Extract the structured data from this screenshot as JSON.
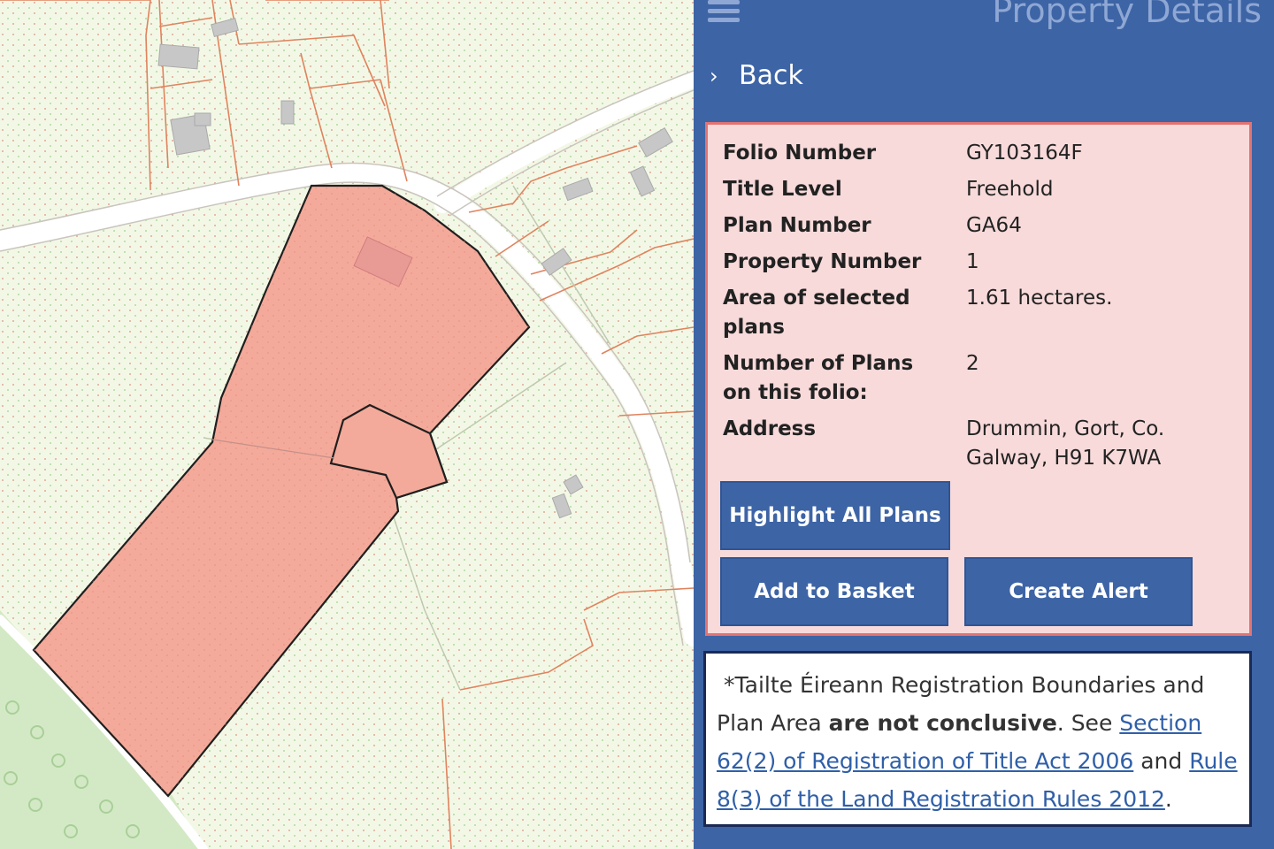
{
  "header": {
    "title": "Property Details",
    "menu_icon": "hamburger-icon"
  },
  "back": {
    "label": "Back",
    "icon": "chevron-right-icon"
  },
  "details": [
    {
      "label": "Folio Number",
      "value": "GY103164F"
    },
    {
      "label": "Title Level",
      "value": "Freehold"
    },
    {
      "label": "Plan Number",
      "value": "GA64"
    },
    {
      "label": "Property Number",
      "value": "1"
    },
    {
      "label": "Area of selected plans",
      "value": "1.61 hectares."
    },
    {
      "label": "Number of Plans on this folio:",
      "value": "2"
    },
    {
      "label": "Address",
      "value": "Drummin, Gort, Co. Galway, H91 K7WA"
    }
  ],
  "buttons": {
    "highlight": "Highlight All Plans",
    "basket": "Add to Basket",
    "alert": "Create Alert"
  },
  "note": {
    "text1": "*Tailte Éireann Registration Boundaries and Plan Area ",
    "bold": "are not conclusive",
    "text2": ". See ",
    "link1": "Section 62(2) of Registration of Title Act 2006",
    "text3": " and ",
    "link2": "Rule 8(3) of the Land Registration Rules 2012",
    "text4": "."
  },
  "colors": {
    "panel": "#3d64a5",
    "card_bg": "#f8dada",
    "card_border": "#e27373",
    "parcel_fill": "#f4aa9a",
    "map_bg": "#f2f7e3",
    "woodland": "#cfe6c0"
  }
}
